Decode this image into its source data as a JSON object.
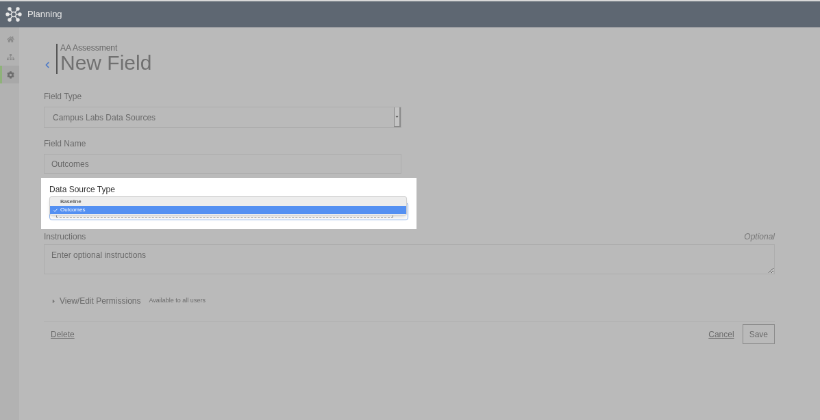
{
  "header": {
    "title": "Planning"
  },
  "sidebar": {
    "items": [
      {
        "kind": "home",
        "selected": false
      },
      {
        "kind": "sitemap",
        "selected": false
      },
      {
        "kind": "settings",
        "selected": true
      }
    ]
  },
  "page": {
    "breadcrumb": "AA Assessment",
    "title": "New Field"
  },
  "field_type": {
    "label": "Field Type",
    "value": "Campus Labs Data Sources"
  },
  "field_name": {
    "label": "Field Name",
    "value": "Outcomes"
  },
  "data_source_type": {
    "label": "Data Source Type",
    "options": [
      {
        "label": "Baseline",
        "selected": false
      },
      {
        "label": "Outcomes",
        "selected": true
      }
    ]
  },
  "instructions": {
    "label": "Instructions",
    "optional": "Optional",
    "placeholder": "Enter optional instructions"
  },
  "permissions": {
    "label": "View/Edit Permissions",
    "note": "Available to all users",
    "expanded": false
  },
  "actions": {
    "delete": "Delete",
    "cancel": "Cancel",
    "save": "Save"
  }
}
